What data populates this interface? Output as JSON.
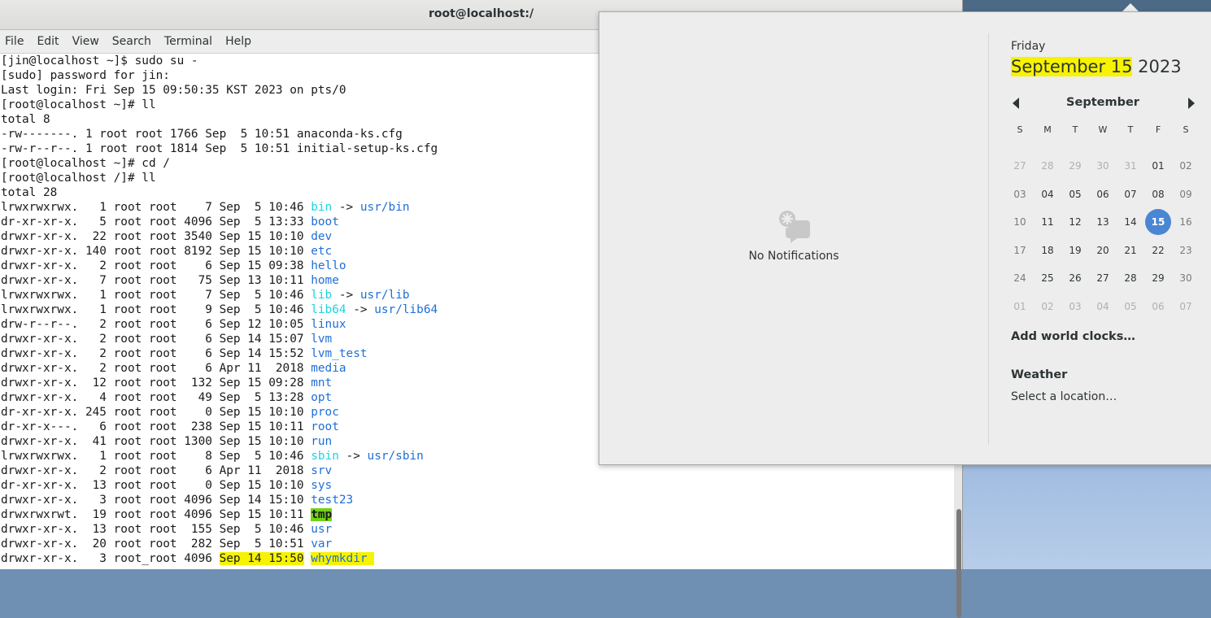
{
  "terminal": {
    "title": "root@localhost:/",
    "menu": [
      "File",
      "Edit",
      "View",
      "Search",
      "Terminal",
      "Help"
    ],
    "lines": [
      [
        {
          "t": "[jin@localhost ~]$ sudo su -"
        }
      ],
      [
        {
          "t": "[sudo] password for jin:"
        }
      ],
      [
        {
          "t": "Last login: Fri Sep 15 09:50:35 KST 2023 on pts/0"
        }
      ],
      [
        {
          "t": "[root@localhost ~]# ll"
        }
      ],
      [
        {
          "t": "total 8"
        }
      ],
      [
        {
          "t": "-rw-------. 1 root root 1766 Sep  5 10:51 anaconda-ks.cfg"
        }
      ],
      [
        {
          "t": "-rw-r--r--. 1 root root 1814 Sep  5 10:51 initial-setup-ks.cfg"
        }
      ],
      [
        {
          "t": "[root@localhost ~]# cd /"
        }
      ],
      [
        {
          "t": "[root@localhost /]# ll"
        }
      ],
      [
        {
          "t": "total 28"
        }
      ],
      [
        {
          "t": "lrwxrwxrwx.   1 root root    7 Sep  5 10:46 "
        },
        {
          "t": "bin",
          "c": "cyan"
        },
        {
          "t": " -> "
        },
        {
          "t": "usr/bin",
          "c": "blue"
        }
      ],
      [
        {
          "t": "dr-xr-xr-x.   5 root root 4096 Sep  5 13:33 "
        },
        {
          "t": "boot",
          "c": "blue"
        }
      ],
      [
        {
          "t": "drwxr-xr-x.  22 root root 3540 Sep 15 10:10 "
        },
        {
          "t": "dev",
          "c": "blue"
        }
      ],
      [
        {
          "t": "drwxr-xr-x. 140 root root 8192 Sep 15 10:10 "
        },
        {
          "t": "etc",
          "c": "blue"
        }
      ],
      [
        {
          "t": "drwxr-xr-x.   2 root root    6 Sep 15 09:38 "
        },
        {
          "t": "hello",
          "c": "blue"
        }
      ],
      [
        {
          "t": "drwxr-xr-x.   7 root root   75 Sep 13 10:11 "
        },
        {
          "t": "home",
          "c": "blue"
        }
      ],
      [
        {
          "t": "lrwxrwxrwx.   1 root root    7 Sep  5 10:46 "
        },
        {
          "t": "lib",
          "c": "cyan"
        },
        {
          "t": " -> "
        },
        {
          "t": "usr/lib",
          "c": "blue"
        }
      ],
      [
        {
          "t": "lrwxrwxrwx.   1 root root    9 Sep  5 10:46 "
        },
        {
          "t": "lib64",
          "c": "cyan"
        },
        {
          "t": " -> "
        },
        {
          "t": "usr/lib64",
          "c": "blue"
        }
      ],
      [
        {
          "t": "drw-r--r--.   2 root root    6 Sep 12 10:05 "
        },
        {
          "t": "linux",
          "c": "blue"
        }
      ],
      [
        {
          "t": "drwxr-xr-x.   2 root root    6 Sep 14 15:07 "
        },
        {
          "t": "lvm",
          "c": "blue"
        }
      ],
      [
        {
          "t": "drwxr-xr-x.   2 root root    6 Sep 14 15:52 "
        },
        {
          "t": "lvm_test",
          "c": "blue"
        }
      ],
      [
        {
          "t": "drwxr-xr-x.   2 root root    6 Apr 11  2018 "
        },
        {
          "t": "media",
          "c": "blue"
        }
      ],
      [
        {
          "t": "drwxr-xr-x.  12 root root  132 Sep 15 09:28 "
        },
        {
          "t": "mnt",
          "c": "blue"
        }
      ],
      [
        {
          "t": "drwxr-xr-x.   4 root root   49 Sep  5 13:28 "
        },
        {
          "t": "opt",
          "c": "blue"
        }
      ],
      [
        {
          "t": "dr-xr-xr-x. 245 root root    0 Sep 15 10:10 "
        },
        {
          "t": "proc",
          "c": "blue"
        }
      ],
      [
        {
          "t": "dr-xr-x---.   6 root root  238 Sep 15 10:11 "
        },
        {
          "t": "root",
          "c": "blue"
        }
      ],
      [
        {
          "t": "drwxr-xr-x.  41 root root 1300 Sep 15 10:10 "
        },
        {
          "t": "run",
          "c": "blue"
        }
      ],
      [
        {
          "t": "lrwxrwxrwx.   1 root root    8 Sep  5 10:46 "
        },
        {
          "t": "sbin",
          "c": "cyan"
        },
        {
          "t": " -> "
        },
        {
          "t": "usr/sbin",
          "c": "blue"
        }
      ],
      [
        {
          "t": "drwxr-xr-x.   2 root root    6 Apr 11  2018 "
        },
        {
          "t": "srv",
          "c": "blue"
        }
      ],
      [
        {
          "t": "dr-xr-xr-x.  13 root root    0 Sep 15 10:10 "
        },
        {
          "t": "sys",
          "c": "blue"
        }
      ],
      [
        {
          "t": "drwxr-xr-x.   3 root root 4096 Sep 14 15:10 "
        },
        {
          "t": "test23",
          "c": "blue"
        }
      ],
      [
        {
          "t": "drwxrwxrwt.  19 root root 4096 Sep 15 10:11 "
        },
        {
          "t": "tmp",
          "c": "hl-green"
        }
      ],
      [
        {
          "t": "drwxr-xr-x.  13 root root  155 Sep  5 10:46 "
        },
        {
          "t": "usr",
          "c": "blue"
        }
      ],
      [
        {
          "t": "drwxr-xr-x.  20 root root  282 Sep  5 10:51 "
        },
        {
          "t": "var",
          "c": "blue"
        }
      ],
      [
        {
          "t": "drwxr-xr-x.   3 root_root 4096 "
        },
        {
          "t": "Sep 14 15:50",
          "c": "hl-yellow"
        },
        {
          "t": " "
        },
        {
          "t": "whymkdir ",
          "c": "hl-yellow-blue"
        }
      ]
    ]
  },
  "notifications": {
    "empty_label": "No Notifications",
    "icon": "chat-bubble-icon"
  },
  "calendar": {
    "day_name": "Friday",
    "date_highlight": "September 15",
    "date_year": " 2023",
    "month": "September",
    "weekdays": [
      "S",
      "M",
      "T",
      "W",
      "T",
      "F",
      "S"
    ],
    "weeks": [
      [
        "27",
        "28",
        "29",
        "30",
        "31",
        "01",
        "02"
      ],
      [
        "03",
        "04",
        "05",
        "06",
        "07",
        "08",
        "09"
      ],
      [
        "10",
        "11",
        "12",
        "13",
        "14",
        "15",
        "16"
      ],
      [
        "17",
        "18",
        "19",
        "20",
        "21",
        "22",
        "23"
      ],
      [
        "24",
        "25",
        "26",
        "27",
        "28",
        "29",
        "30"
      ],
      [
        "01",
        "02",
        "03",
        "04",
        "05",
        "06",
        "07"
      ]
    ],
    "today": "15",
    "add_world_clocks": "Add world clocks…",
    "weather_title": "Weather",
    "weather_subtitle": "Select a location…"
  },
  "colors": {
    "link_blue": "#1f6fd6",
    "symlink_cyan": "#1fd3e0",
    "highlight_yellow": "#f7f300",
    "highlight_green": "#73d216",
    "today_blue": "#4a86d4"
  }
}
